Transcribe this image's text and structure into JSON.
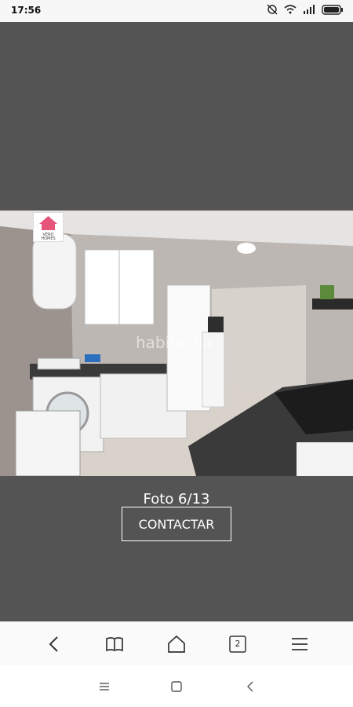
{
  "status": {
    "time": "17:56",
    "icons": [
      "alarm-off-icon",
      "wifi-icon",
      "signal-icon",
      "battery-icon"
    ]
  },
  "gallery": {
    "caption": "Foto 6/13",
    "contact_label": "CONTACTAR",
    "watermark": "habitaclia",
    "logo_lines": [
      "VERO",
      "HOMES"
    ]
  },
  "browser": {
    "tab_count": "2"
  },
  "colors": {
    "background": "#545454",
    "bar": "#fafafa"
  }
}
